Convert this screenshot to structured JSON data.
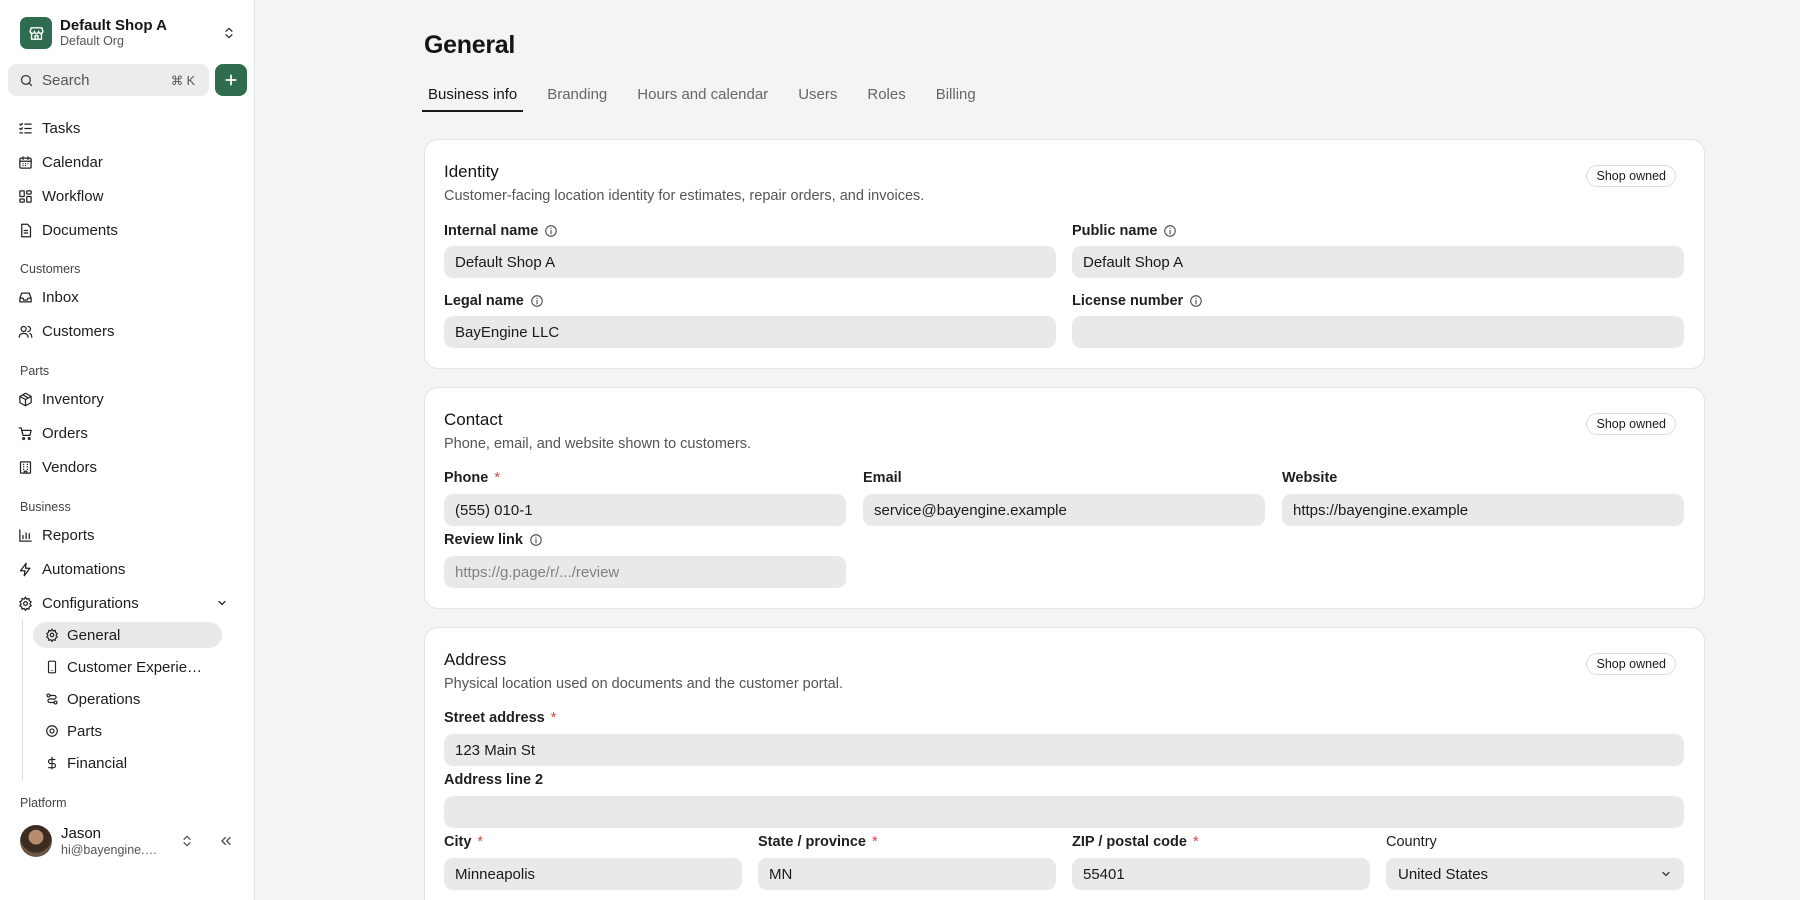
{
  "shop": {
    "name": "Default Shop A",
    "org": "Default Org"
  },
  "search": {
    "label": "Search",
    "shortcut": "⌘ K"
  },
  "nav": {
    "tasks": "Tasks",
    "calendar": "Calendar",
    "workflow": "Workflow",
    "documents": "Documents",
    "section_customers": "Customers",
    "inbox": "Inbox",
    "customers": "Customers",
    "section_parts": "Parts",
    "inventory": "Inventory",
    "orders": "Orders",
    "vendors": "Vendors",
    "section_business": "Business",
    "reports": "Reports",
    "automations": "Automations",
    "configurations": "Configurations",
    "sub": {
      "general": "General",
      "customer_experience": "Customer Experience",
      "operations": "Operations",
      "parts": "Parts",
      "financial": "Financial"
    },
    "section_platform": "Platform"
  },
  "user": {
    "name": "Jason",
    "email": "hi@bayengine.com"
  },
  "page": {
    "title": "General"
  },
  "tabs": [
    "Business info",
    "Branding",
    "Hours and calendar",
    "Users",
    "Roles",
    "Billing"
  ],
  "identity": {
    "title": "Identity",
    "subtitle": "Customer-facing location identity for estimates, repair orders, and invoices.",
    "badge": "Shop owned",
    "internal_name_label": "Internal name",
    "internal_name_value": "Default Shop A",
    "public_name_label": "Public name",
    "public_name_value": "Default Shop A",
    "legal_name_label": "Legal name",
    "legal_name_value": "BayEngine LLC",
    "license_label": "License number",
    "license_value": ""
  },
  "contact": {
    "title": "Contact",
    "subtitle": "Phone, email, and website shown to customers.",
    "badge": "Shop owned",
    "phone_label": "Phone",
    "phone_value": "(555) 010-1",
    "email_label": "Email",
    "email_value": "service@bayengine.example",
    "website_label": "Website",
    "website_value": "https://bayengine.example",
    "review_label": "Review link",
    "review_placeholder": "https://g.page/r/.../review"
  },
  "address": {
    "title": "Address",
    "subtitle": "Physical location used on documents and the customer portal.",
    "badge": "Shop owned",
    "street_label": "Street address",
    "street_value": "123 Main St",
    "line2_label": "Address line 2",
    "line2_value": "",
    "city_label": "City",
    "city_value": "Minneapolis",
    "state_label": "State / province",
    "state_value": "MN",
    "zip_label": "ZIP / postal code",
    "zip_value": "55401",
    "country_label": "Country",
    "country_value": "United States"
  },
  "colors": {
    "brand": "#2f6b4f",
    "required": "#d64545",
    "input_bg": "#e9e9e9"
  }
}
